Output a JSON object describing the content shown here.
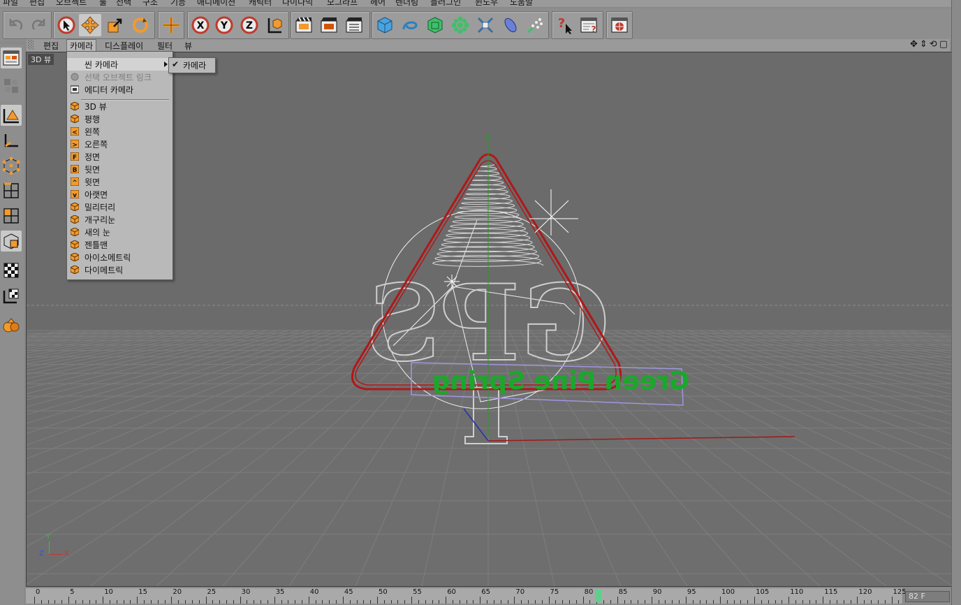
{
  "menubar": {
    "items": [
      "파일",
      "편집",
      "오브젝트",
      "툴",
      "선택",
      "구조",
      "기능",
      "애니메이션",
      "캐릭터",
      "다이나믹",
      "모그라프",
      "헤어",
      "렌더링",
      "플러그인",
      "윈도우",
      "도움말"
    ]
  },
  "toolbar": {
    "icons": [
      "undo-icon",
      "redo-icon",
      "live-select-icon",
      "move-icon",
      "scale-icon",
      "rotate-icon",
      "coordinate-icon",
      "x-axis-lock-icon",
      "y-axis-lock-icon",
      "z-axis-lock-icon",
      "world-coordinate-icon",
      "render-view-icon",
      "render-picture-viewer-icon",
      "render-settings-icon",
      "cube-primitive-icon",
      "spline-icon",
      "nurbs-icon",
      "array-icon",
      "deformer-icon",
      "scene-object-icon",
      "particle-icon",
      "help-pointer-icon",
      "layout-settings-icon",
      "browser-icon"
    ]
  },
  "viewmenu": {
    "items": [
      "편집",
      "카메라",
      "디스플레이",
      "필터",
      "뷰"
    ],
    "open_index": 1
  },
  "viewport": {
    "tag": "3D 뷰",
    "axis_y": "Y",
    "axis_z": "Z",
    "axis_x": "X",
    "text_logo": "GPS",
    "green_text": "Green Pine Spring"
  },
  "camera_menu": {
    "items": [
      {
        "label": "씬 카메라",
        "icon": "none",
        "submenu": true,
        "highlight": true
      },
      {
        "label": "선택 오브젝트 링크",
        "icon": "link-camera-icon",
        "disabled": true
      },
      {
        "label": "에디터 카메라",
        "icon": "editor-camera-icon"
      },
      {
        "separator": true
      },
      {
        "label": "3D 뷰",
        "icon": "perspective-icon"
      },
      {
        "label": "평행",
        "icon": "parallel-icon"
      },
      {
        "label": "왼쪽",
        "icon": "left-view-icon"
      },
      {
        "label": "오른쪽",
        "icon": "right-view-icon"
      },
      {
        "label": "정면",
        "icon": "front-view-icon"
      },
      {
        "label": "뒷면",
        "icon": "back-view-icon"
      },
      {
        "label": "윗면",
        "icon": "top-view-icon"
      },
      {
        "label": "아랫면",
        "icon": "bottom-view-icon"
      },
      {
        "label": "밀리터리",
        "icon": "military-view-icon"
      },
      {
        "label": "개구리눈",
        "icon": "frog-view-icon"
      },
      {
        "label": "새의 눈",
        "icon": "bird-view-icon"
      },
      {
        "label": "젠틀맨",
        "icon": "gentleman-view-icon"
      },
      {
        "label": "아이소메트릭",
        "icon": "isometric-view-icon"
      },
      {
        "label": "다이메트릭",
        "icon": "dimetric-view-icon"
      }
    ],
    "icon_letters": {
      "left-view-icon": "<",
      "right-view-icon": ">",
      "front-view-icon": "F",
      "back-view-icon": "B",
      "top-view-icon": "^",
      "bottom-view-icon": "v"
    }
  },
  "submenu": {
    "check": "✔",
    "label": "카메라"
  },
  "timeline": {
    "ticks": [
      "0",
      "5",
      "10",
      "15",
      "20",
      "25",
      "30",
      "35",
      "40",
      "45",
      "50",
      "55",
      "60",
      "65",
      "70",
      "75",
      "80",
      "85",
      "90",
      "95",
      "100",
      "105",
      "110",
      "115",
      "120",
      "125"
    ],
    "current": 82,
    "frame_label": "82 F"
  },
  "colors": {
    "accent": "#f29a2e",
    "grid": "#7a7a7a",
    "triangle": "#b01818",
    "green_text": "#1aa82a"
  }
}
